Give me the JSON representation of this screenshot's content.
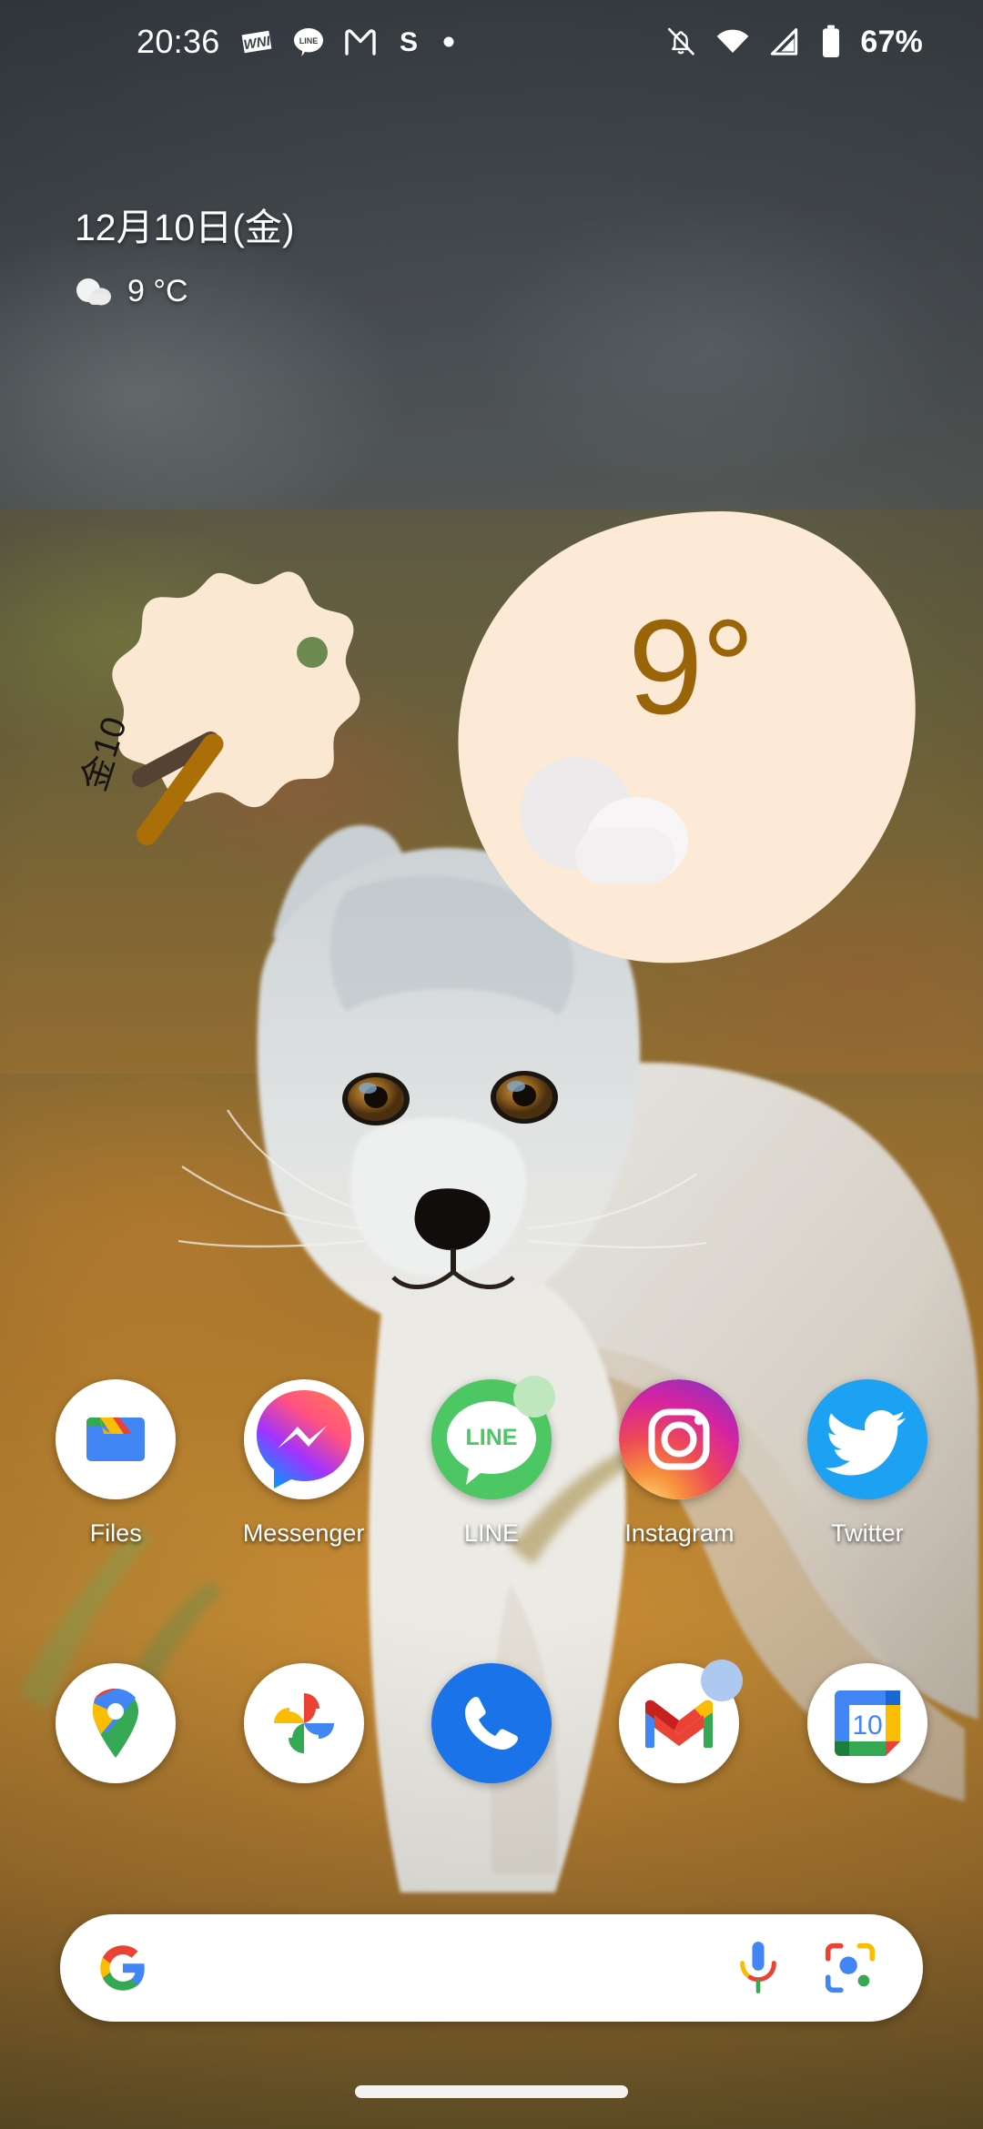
{
  "status_bar": {
    "time": "20:36",
    "battery_percent": "67%",
    "notification_icons": [
      "wni-weather-icon",
      "line-icon",
      "gmail-icon",
      "s-app-icon",
      "dot-icon"
    ],
    "system_icons": [
      "notifications-muted-icon",
      "wifi-icon",
      "cellular-signal-icon",
      "battery-icon"
    ]
  },
  "date_widget": {
    "date": "12月10日(金)",
    "temperature": "9 °C",
    "weather_icon": "cloudy-icon"
  },
  "clock_widget": {
    "day_label": "金10",
    "blob_color": "#FBE8D3",
    "hour_hand_color": "#544332",
    "minute_hand_color": "#AA7007",
    "dot_color": "#6C8A50",
    "displayed_time": "20:36"
  },
  "weather_widget": {
    "temperature": "9°",
    "weather_icon": "cloudy-icon",
    "blob_color": "#FCEAD6",
    "text_color": "#9A6408"
  },
  "app_rows": [
    {
      "row_name": "home-apps-row",
      "apps": [
        {
          "label": "Files",
          "icon": "files-icon",
          "badge": null
        },
        {
          "label": "Messenger",
          "icon": "messenger-icon",
          "badge": null
        },
        {
          "label": "LINE",
          "icon": "line-icon",
          "badge": "#BEE7BE"
        },
        {
          "label": "Instagram",
          "icon": "instagram-icon",
          "badge": null
        },
        {
          "label": "Twitter",
          "icon": "twitter-icon",
          "badge": null
        }
      ]
    },
    {
      "row_name": "dock-row",
      "apps": [
        {
          "label": "",
          "icon": "maps-icon",
          "badge": null
        },
        {
          "label": "",
          "icon": "photos-icon",
          "badge": null
        },
        {
          "label": "",
          "icon": "phone-icon",
          "badge": null
        },
        {
          "label": "",
          "icon": "gmail-icon",
          "badge": "#AEC9F0"
        },
        {
          "label": "",
          "icon": "calendar-icon",
          "badge": null,
          "day_number": "10"
        }
      ]
    }
  ],
  "search_bar": {
    "logo": "google-g-logo",
    "placeholder": "",
    "value": "",
    "actions": [
      "microphone-icon",
      "google-lens-icon"
    ]
  },
  "navigation": {
    "gesture_pill": "home-gesture-pill"
  },
  "colors": {
    "accent_cream": "#FBE8D3",
    "accent_gold": "#AA7007",
    "google_blue": "#4285F4",
    "google_red": "#EA4335",
    "google_yellow": "#FBBC04",
    "google_green": "#34A853"
  }
}
